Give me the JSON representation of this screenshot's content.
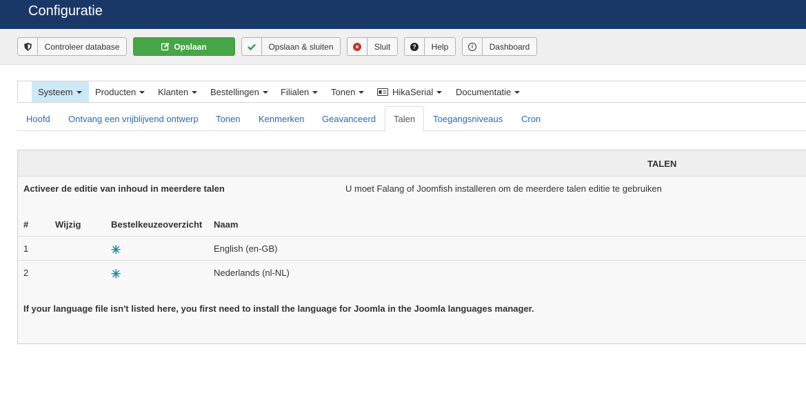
{
  "header": {
    "title": "Configuratie"
  },
  "toolbar": {
    "buttons": [
      {
        "label": "Controleer database",
        "icon": "shield-icon"
      },
      {
        "label": "Opslaan",
        "icon": "edit-icon"
      },
      {
        "label": "Opslaan & sluiten",
        "icon": "checkmark-icon"
      },
      {
        "label": "Sluit",
        "icon": "close-circle-icon"
      },
      {
        "label": "Help",
        "icon": "question-circle-icon"
      },
      {
        "label": "Dashboard",
        "icon": "info-circle-icon"
      }
    ]
  },
  "menu": {
    "items": [
      {
        "label": "Systeem"
      },
      {
        "label": "Producten"
      },
      {
        "label": "Klanten"
      },
      {
        "label": "Bestellingen"
      },
      {
        "label": "Filialen"
      },
      {
        "label": "Tonen"
      },
      {
        "label": "HikaSerial"
      },
      {
        "label": "Documentatie"
      }
    ]
  },
  "tabs": [
    {
      "label": "Hoofd"
    },
    {
      "label": "Ontvang een vrijblijvend ontwerp"
    },
    {
      "label": "Tonen"
    },
    {
      "label": "Kenmerken"
    },
    {
      "label": "Geavanceerd"
    },
    {
      "label": "Talen"
    },
    {
      "label": "Toegangsniveaus"
    },
    {
      "label": "Cron"
    }
  ],
  "panel": {
    "title": "TALEN",
    "setting_label": "Activeer de editie van inhoud in meerdere talen",
    "setting_value": "U moet Falang of Joomfish installeren om de meerdere talen editie te gebruiken",
    "columns": [
      "#",
      "Wijzig",
      "Bestelkeuzeoverzicht",
      "Naam"
    ],
    "rows": [
      {
        "num": "1",
        "name": "English (en-GB)"
      },
      {
        "num": "2",
        "name": "Nederlands (nl-NL)"
      }
    ],
    "note": "If your language file isn't listed here, you first need to install the language for Joomla in the Joomla languages manager."
  },
  "colors": {
    "header_bg": "#1a3867",
    "save_green": "#46a546",
    "link_blue": "#2a69b8",
    "active_menu": "#cde8f7"
  }
}
